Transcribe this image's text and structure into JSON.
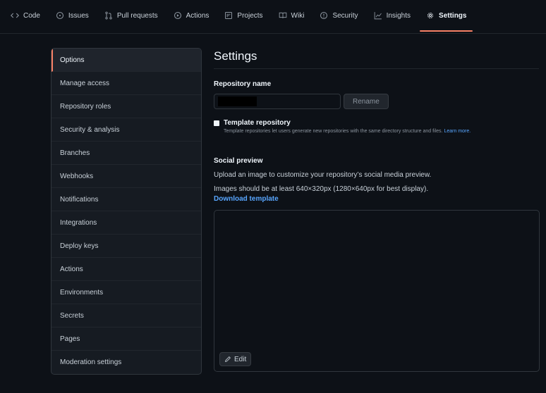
{
  "nav": {
    "tabs": [
      {
        "label": "Code",
        "icon": "code-icon"
      },
      {
        "label": "Issues",
        "icon": "issue-opened-icon"
      },
      {
        "label": "Pull requests",
        "icon": "git-pull-request-icon"
      },
      {
        "label": "Actions",
        "icon": "play-icon"
      },
      {
        "label": "Projects",
        "icon": "project-icon"
      },
      {
        "label": "Wiki",
        "icon": "book-icon"
      },
      {
        "label": "Security",
        "icon": "shield-icon"
      },
      {
        "label": "Insights",
        "icon": "graph-icon"
      },
      {
        "label": "Settings",
        "icon": "gear-icon",
        "selected": true
      }
    ]
  },
  "sidebar": {
    "items": [
      {
        "label": "Options",
        "selected": true
      },
      {
        "label": "Manage access"
      },
      {
        "label": "Repository roles"
      },
      {
        "label": "Security & analysis"
      },
      {
        "label": "Branches"
      },
      {
        "label": "Webhooks"
      },
      {
        "label": "Notifications"
      },
      {
        "label": "Integrations"
      },
      {
        "label": "Deploy keys"
      },
      {
        "label": "Actions"
      },
      {
        "label": "Environments"
      },
      {
        "label": "Secrets"
      },
      {
        "label": "Pages"
      },
      {
        "label": "Moderation settings"
      }
    ]
  },
  "main": {
    "title": "Settings",
    "repo_name_label": "Repository name",
    "repo_name_value": "",
    "rename_label": "Rename",
    "template": {
      "label": "Template repository",
      "description": "Template repositories let users generate new repositories with the same directory structure and files.",
      "learn_more": "Learn more.",
      "checked": false
    },
    "social_preview": {
      "title": "Social preview",
      "description": "Upload an image to customize your repository’s social media preview.",
      "size_hint": "Images should be at least 640×320px (1280×640px for best display).",
      "download_link": "Download template",
      "edit_label": "Edit"
    }
  },
  "colors": {
    "background": "#0d1117",
    "panel": "#161b22",
    "border": "#30363d",
    "accent": "#f78166",
    "link": "#58a6ff"
  }
}
